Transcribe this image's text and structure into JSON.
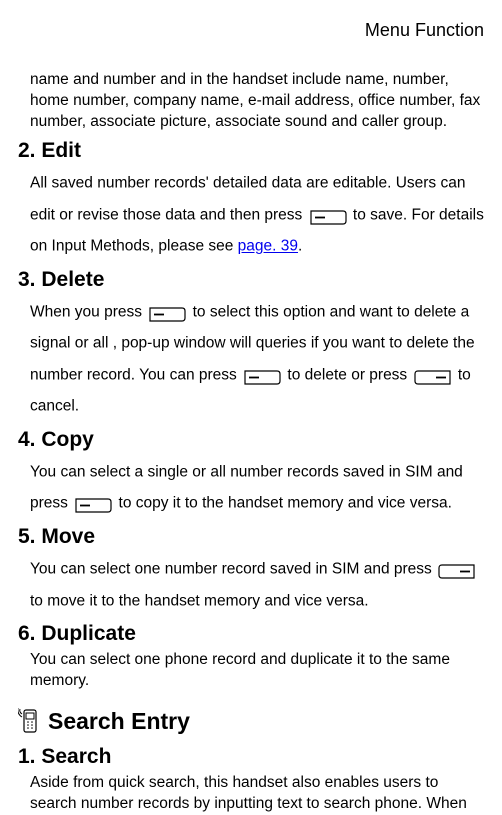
{
  "header": "Menu Function",
  "intro": "name and number and in the handset include name, number, home number, company name, e-mail address, office number, fax number, associate picture, associate sound and caller group.",
  "s2": {
    "title": "2. Edit",
    "t1": "All saved number records' detailed data are editable. Users can edit or revise those data and then press ",
    "t2": " to save. For details on Input Methods, please see ",
    "link": "page. 39",
    "t3": "."
  },
  "s3": {
    "title": "3. Delete",
    "t1": "When you press ",
    "t2": " to select this option and want to delete a signal or all , pop-up window will queries if you want to delete the number record. You can press ",
    "t3": " to delete or press ",
    "t4": " to cancel."
  },
  "s4": {
    "title": "4. Copy",
    "t1": "You can select a single or all number records saved in SIM and press ",
    "t2": " to copy it to the handset memory and vice versa."
  },
  "s5": {
    "title": "5. Move",
    "t1": "You can select one number record saved in SIM and press ",
    "t2": " to move it to the handset memory and vice versa."
  },
  "s6": {
    "title": "6. Duplicate",
    "t1": "You can select one phone record and duplicate it to the same memory."
  },
  "searchEntry": {
    "title": "Search Entry"
  },
  "s1b": {
    "title": "1. Search",
    "t1": "Aside from quick search, this handset also enables users to search number records by inputting text to search phone. When"
  }
}
